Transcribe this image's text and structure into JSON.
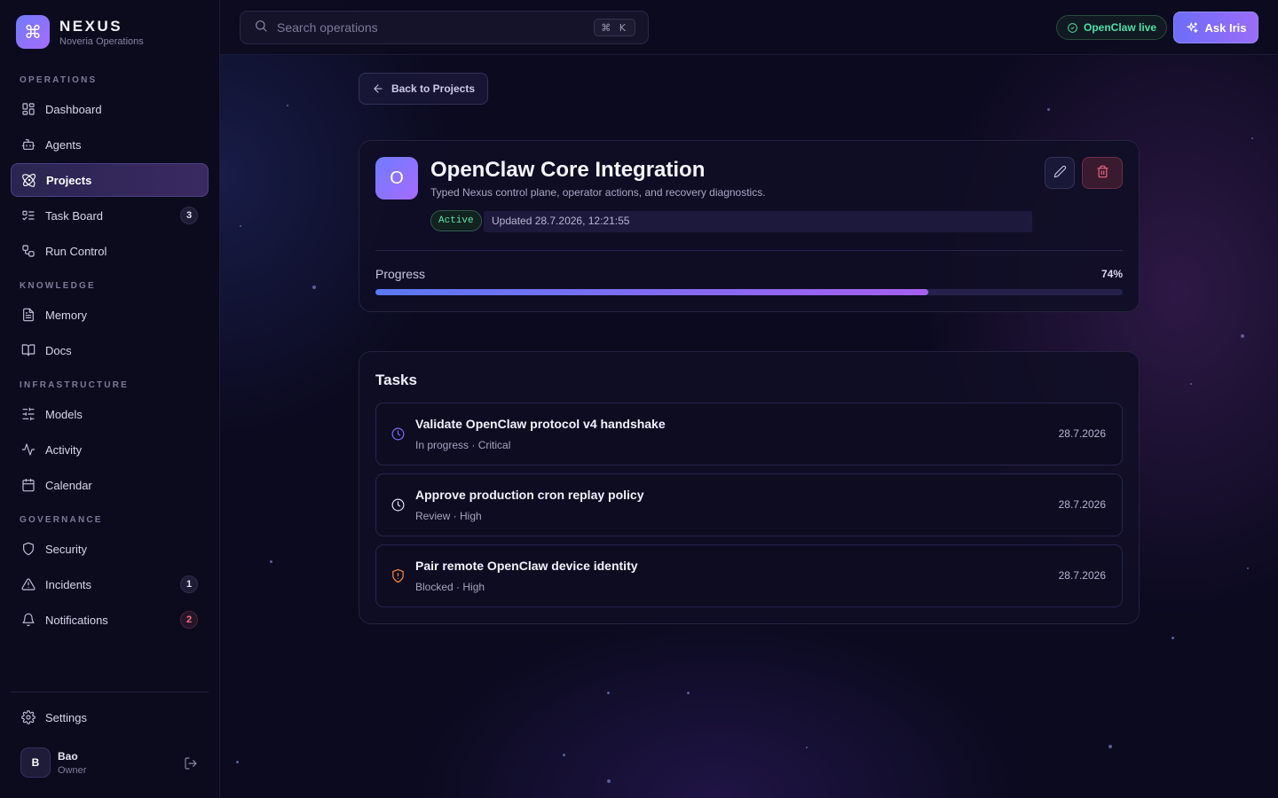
{
  "brand": {
    "name": "NEXUS",
    "subtitle": "Noveria Operations",
    "logo_glyph": "⌘"
  },
  "sidebar": {
    "sections": [
      {
        "label": "OPERATIONS"
      },
      {
        "label": "KNOWLEDGE"
      },
      {
        "label": "INFRASTRUCTURE"
      },
      {
        "label": "GOVERNANCE"
      }
    ],
    "items": [
      {
        "label": "Dashboard",
        "icon": "grid-icon"
      },
      {
        "label": "Agents",
        "icon": "bot-icon"
      },
      {
        "label": "Projects",
        "icon": "atom-icon",
        "active": true
      },
      {
        "label": "Task Board",
        "icon": "list-check-icon",
        "badge": "3"
      },
      {
        "label": "Run Control",
        "icon": "route-icon"
      },
      {
        "label": "Memory",
        "icon": "file-text-icon"
      },
      {
        "label": "Docs",
        "icon": "book-icon"
      },
      {
        "label": "Models",
        "icon": "sliders-icon"
      },
      {
        "label": "Activity",
        "icon": "pulse-icon"
      },
      {
        "label": "Calendar",
        "icon": "calendar-icon"
      },
      {
        "label": "Security",
        "icon": "shield-icon"
      },
      {
        "label": "Incidents",
        "icon": "warning-icon",
        "badge": "1"
      },
      {
        "label": "Notifications",
        "icon": "bell-icon",
        "badge": "2"
      }
    ],
    "settings_label": "Settings",
    "user": {
      "initial": "B",
      "name": "Bao",
      "role": "Owner"
    }
  },
  "topbar": {
    "search_placeholder": "Search operations",
    "shortcut": "⌘ K",
    "live_label": "OpenClaw live",
    "ask_label": "Ask Iris"
  },
  "back_label": "Back to Projects",
  "project": {
    "initial": "O",
    "title": "OpenClaw Core Integration",
    "description": "Typed Nexus control plane, operator actions, and recovery diagnostics.",
    "status": "Active",
    "updated": "Updated 28.7.2026, 12:21:55",
    "progress_label": "Progress",
    "progress_percent": 74,
    "progress_text": "74%"
  },
  "tasks": {
    "title": "Tasks",
    "items": [
      {
        "title": "Validate OpenClaw protocol v4 handshake",
        "meta": "In progress · Critical",
        "date": "28.7.2026",
        "icon": "clock-icon",
        "color": "#7b6ff5"
      },
      {
        "title": "Approve production cron replay policy",
        "meta": "Review · High",
        "date": "28.7.2026",
        "icon": "clock-icon",
        "color": "#e4e2f2"
      },
      {
        "title": "Pair remote OpenClaw device identity",
        "meta": "Blocked · High",
        "date": "28.7.2026",
        "icon": "shield-alert-icon",
        "color": "#ff8a3d"
      }
    ]
  },
  "colors": {
    "accent": "#8b6ff7",
    "live": "#4fe0a6",
    "danger": "#ff6f86",
    "blocked": "#ff8a3d"
  }
}
